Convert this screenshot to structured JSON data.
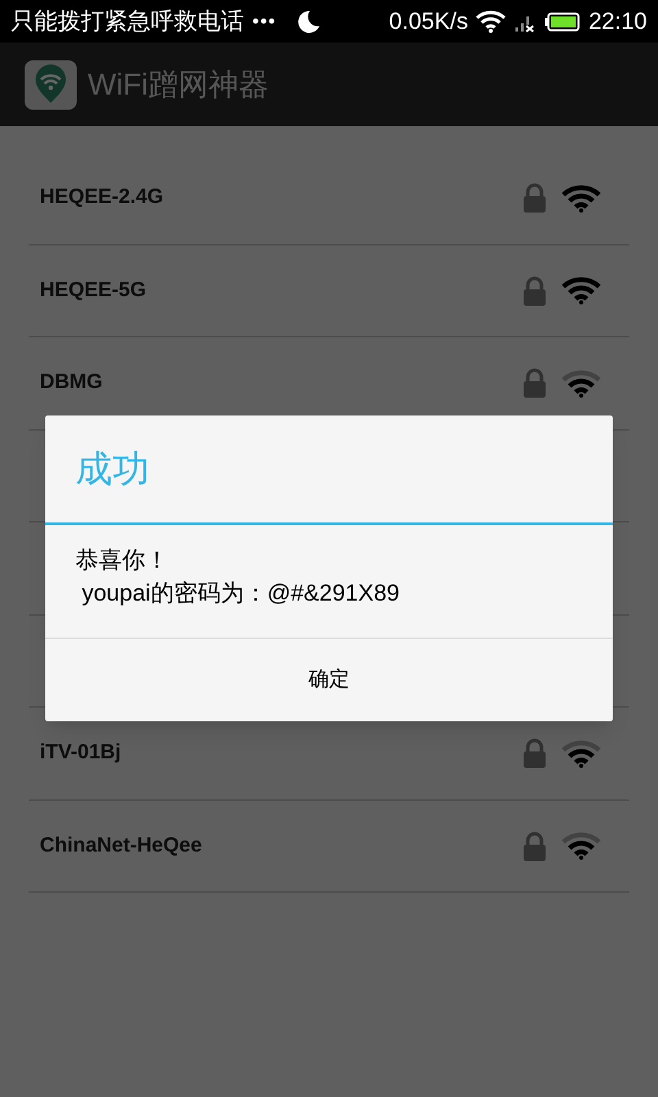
{
  "status_bar": {
    "notice": "只能拨打紧急呼救电话",
    "dots": "•••",
    "speed": "0.05K/s",
    "time": "22:10"
  },
  "app_bar": {
    "title": "WiFi蹭网神器"
  },
  "networks": [
    {
      "name": "HEQEE-2.4G",
      "locked": true,
      "full_signal": true
    },
    {
      "name": "HEQEE-5G",
      "locked": true,
      "full_signal": true
    },
    {
      "name": "DBMG",
      "locked": true,
      "full_signal": false
    },
    {
      "name": "iTV-01Bj",
      "locked": true,
      "full_signal": false
    },
    {
      "name": "ChinaNet-HeQee",
      "locked": true,
      "full_signal": false
    }
  ],
  "dialog": {
    "title": "成功",
    "message": [
      "恭喜你！",
      " youpai的密码为：@#&291X89"
    ],
    "button": "确定"
  }
}
